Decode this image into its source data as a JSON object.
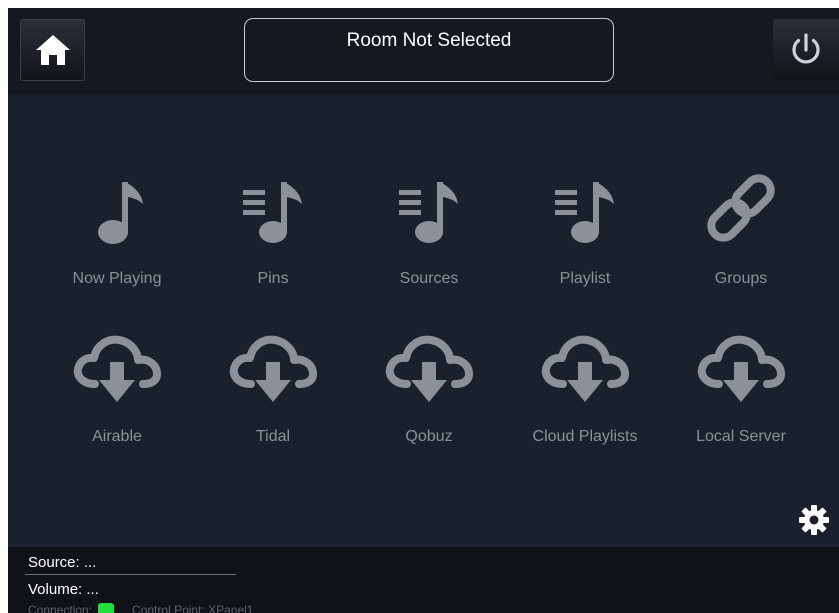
{
  "header": {
    "room_status": "Room Not Selected",
    "home_icon": "home-icon",
    "power_icon": "power-icon"
  },
  "tiles": [
    {
      "label": "Now Playing",
      "icon": "music-note-icon"
    },
    {
      "label": "Pins",
      "icon": "music-list-icon"
    },
    {
      "label": "Sources",
      "icon": "music-list-icon"
    },
    {
      "label": "Playlist",
      "icon": "music-list-icon"
    },
    {
      "label": "Groups",
      "icon": "link-icon"
    },
    {
      "label": "Airable",
      "icon": "cloud-download-icon"
    },
    {
      "label": "Tidal",
      "icon": "cloud-download-icon"
    },
    {
      "label": "Qobuz",
      "icon": "cloud-download-icon"
    },
    {
      "label": "Cloud Playlists",
      "icon": "cloud-download-icon"
    },
    {
      "label": "Local Server",
      "icon": "cloud-download-icon"
    }
  ],
  "settings_icon": "gear-icon",
  "footer": {
    "source": "Source:  ...",
    "volume": "Volume:  ...",
    "connection_label": "Connection:",
    "control_point": "Control Point: XPanel1"
  },
  "colors": {
    "background": "#1b212c",
    "header": "#141920",
    "icon": "#8b9099",
    "connection_ok": "#22e03a"
  }
}
